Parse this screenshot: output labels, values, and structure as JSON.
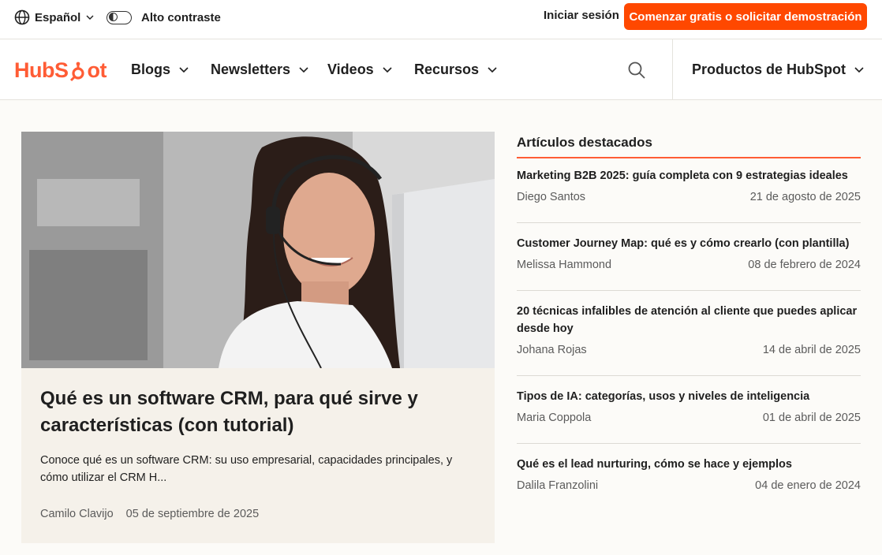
{
  "utility": {
    "language": "Español",
    "contrast_label": "Alto contraste",
    "login": "Iniciar sesión",
    "cta": "Comenzar gratis o solicitar demostración"
  },
  "brand": {
    "logo_text_left": "HubS",
    "logo_text_right": "ot",
    "accent": "#ff5c35",
    "cta_color": "#ff4800"
  },
  "nav": {
    "items": [
      {
        "label": "Blogs"
      },
      {
        "label": "Newsletters"
      },
      {
        "label": "Videos"
      },
      {
        "label": "Recursos"
      }
    ],
    "products": "Productos de HubSpot"
  },
  "hero": {
    "title": "Qué es un software CRM, para qué sirve y características (con tutorial)",
    "description": "Conoce qué es un software CRM: su uso empresarial, capacidades principales, y cómo utilizar el CRM H...",
    "author": "Camilo Clavijo",
    "date": "05 de septiembre de 2025"
  },
  "featured": {
    "heading": "Artículos destacados",
    "articles": [
      {
        "title": "Marketing B2B 2025: guía completa con 9 estrategias ideales",
        "author": "Diego Santos",
        "date": "21 de agosto de 2025"
      },
      {
        "title": "Customer Journey Map: qué es y cómo crearlo (con plantilla)",
        "author": "Melissa Hammond",
        "date": "08 de febrero de 2024"
      },
      {
        "title": "20 técnicas infalibles de atención al cliente que puedes aplicar desde hoy",
        "author": "Johana Rojas",
        "date": "14 de abril de 2025"
      },
      {
        "title": "Tipos de IA: categorías, usos y niveles de inteligencia",
        "author": "Maria Coppola",
        "date": "01 de abril de 2025"
      },
      {
        "title": "Qué es el lead nurturing, cómo se hace y ejemplos",
        "author": "Dalila Franzolini",
        "date": "04 de enero de 2024"
      }
    ]
  }
}
